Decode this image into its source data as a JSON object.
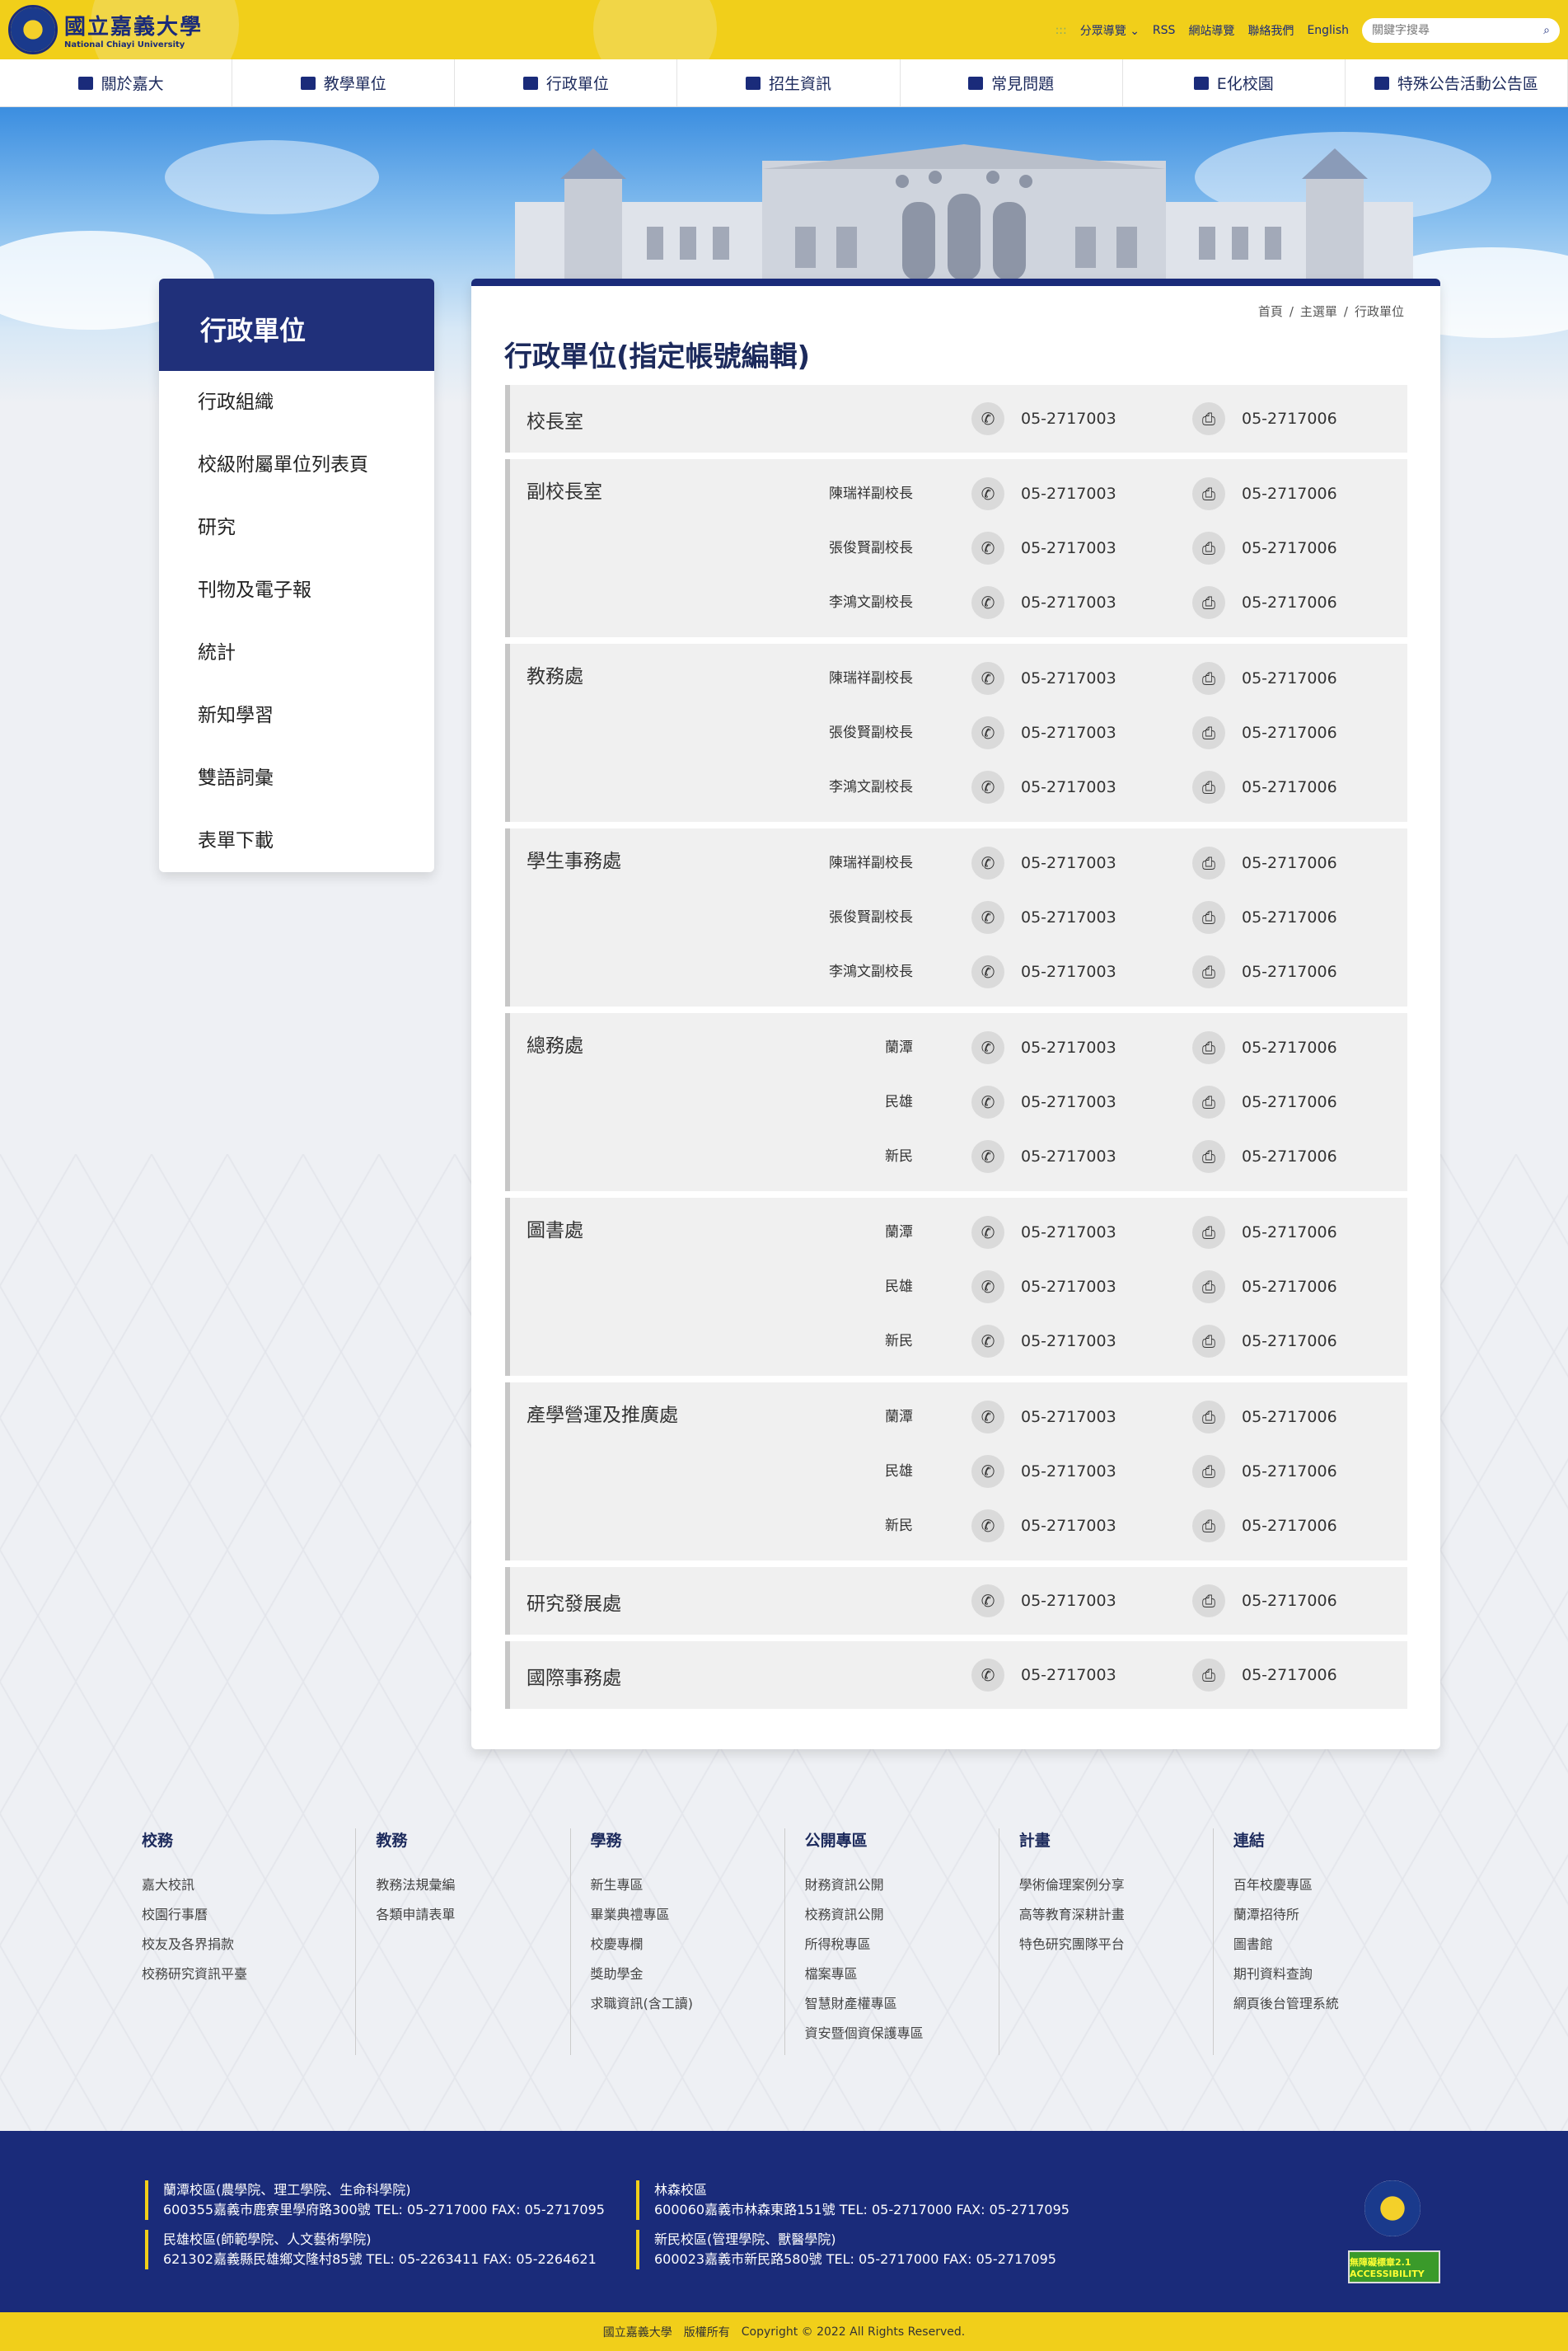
{
  "header": {
    "logo_zh": "國立嘉義大學",
    "logo_en": "National Chiayi University",
    "util": {
      "access": ":::",
      "sitemap_menu": "分眾導覽",
      "rss": "RSS",
      "sitemap": "網站導覽",
      "contact": "聯絡我們",
      "english": "English"
    },
    "search_placeholder": "關鍵字搜尋"
  },
  "nav": [
    "關於嘉大",
    "教學單位",
    "行政單位",
    "招生資訊",
    "常見問題",
    "E化校園",
    "特殊公告活動公告區"
  ],
  "sidebar": {
    "title": "行政單位",
    "items": [
      "行政組織",
      "校級附屬單位列表頁",
      "研究",
      "刊物及電子報",
      "統計",
      "新知學習",
      "雙語詞彙",
      "表單下載"
    ]
  },
  "breadcrumb": [
    "首頁",
    "/",
    "主選單",
    "/",
    "行政單位"
  ],
  "page_title": "行政單位(指定帳號編輯)",
  "units": [
    {
      "name": "校長室",
      "rows": [
        {
          "label": "",
          "tel": "05-2717003",
          "fax": "05-2717006"
        }
      ]
    },
    {
      "name": "副校長室",
      "rows": [
        {
          "label": "陳瑞祥副校長",
          "tel": "05-2717003",
          "fax": "05-2717006"
        },
        {
          "label": "張俊賢副校長",
          "tel": "05-2717003",
          "fax": "05-2717006"
        },
        {
          "label": "李鴻文副校長",
          "tel": "05-2717003",
          "fax": "05-2717006"
        }
      ]
    },
    {
      "name": "教務處",
      "rows": [
        {
          "label": "陳瑞祥副校長",
          "tel": "05-2717003",
          "fax": "05-2717006"
        },
        {
          "label": "張俊賢副校長",
          "tel": "05-2717003",
          "fax": "05-2717006"
        },
        {
          "label": "李鴻文副校長",
          "tel": "05-2717003",
          "fax": "05-2717006"
        }
      ]
    },
    {
      "name": "學生事務處",
      "rows": [
        {
          "label": "陳瑞祥副校長",
          "tel": "05-2717003",
          "fax": "05-2717006"
        },
        {
          "label": "張俊賢副校長",
          "tel": "05-2717003",
          "fax": "05-2717006"
        },
        {
          "label": "李鴻文副校長",
          "tel": "05-2717003",
          "fax": "05-2717006"
        }
      ]
    },
    {
      "name": "總務處",
      "rows": [
        {
          "label": "蘭潭",
          "tel": "05-2717003",
          "fax": "05-2717006"
        },
        {
          "label": "民雄",
          "tel": "05-2717003",
          "fax": "05-2717006"
        },
        {
          "label": "新民",
          "tel": "05-2717003",
          "fax": "05-2717006"
        }
      ]
    },
    {
      "name": "圖書處",
      "rows": [
        {
          "label": "蘭潭",
          "tel": "05-2717003",
          "fax": "05-2717006"
        },
        {
          "label": "民雄",
          "tel": "05-2717003",
          "fax": "05-2717006"
        },
        {
          "label": "新民",
          "tel": "05-2717003",
          "fax": "05-2717006"
        }
      ]
    },
    {
      "name": "產學營運及推廣處",
      "rows": [
        {
          "label": "蘭潭",
          "tel": "05-2717003",
          "fax": "05-2717006"
        },
        {
          "label": "民雄",
          "tel": "05-2717003",
          "fax": "05-2717006"
        },
        {
          "label": "新民",
          "tel": "05-2717003",
          "fax": "05-2717006"
        }
      ]
    },
    {
      "name": "研究發展處",
      "rows": [
        {
          "label": "",
          "tel": "05-2717003",
          "fax": "05-2717006"
        }
      ]
    },
    {
      "name": "國際事務處",
      "rows": [
        {
          "label": "",
          "tel": "05-2717003",
          "fax": "05-2717006"
        }
      ]
    }
  ],
  "footer_links": [
    {
      "title": "校務",
      "items": [
        "嘉大校訊",
        "校園行事曆",
        "校友及各界捐款",
        "校務研究資訊平臺"
      ]
    },
    {
      "title": "教務",
      "items": [
        "教務法規彙編",
        "各類申請表單"
      ]
    },
    {
      "title": "學務",
      "items": [
        "新生專區",
        "畢業典禮專區",
        "校慶專欄",
        "獎助學金",
        "求職資訊(含工讀)"
      ]
    },
    {
      "title": "公開專區",
      "items": [
        "財務資訊公開",
        "校務資訊公開",
        "所得稅專區",
        "檔案專區",
        "智慧財產權專區",
        "資安暨個資保護專區"
      ]
    },
    {
      "title": "計畫",
      "items": [
        "學術倫理案例分享",
        "高等教育深耕計畫",
        "特色研究團隊平台"
      ]
    },
    {
      "title": "連結",
      "items": [
        "百年校慶專區",
        "蘭潭招待所",
        "圖書館",
        "期刊資料查詢",
        "網頁後台管理系統"
      ]
    }
  ],
  "campuses": [
    {
      "name": "蘭潭校區(農學院、理工學院、生命科學院)",
      "addr": "600355嘉義市鹿寮里學府路300號 TEL: 05-2717000 FAX: 05-2717095"
    },
    {
      "name": "林森校區",
      "addr": "600060嘉義市林森東路151號 TEL: 05-2717000 FAX: 05-2717095"
    },
    {
      "name": "民雄校區(師範學院、人文藝術學院)",
      "addr": "621302嘉義縣民雄鄉文隆村85號 TEL: 05-2263411 FAX: 05-2264621"
    },
    {
      "name": "新民校區(管理學院、獸醫學院)",
      "addr": "600023嘉義市新民路580號 TEL: 05-2717000 FAX: 05-2717095"
    }
  ],
  "accessibility_badge": "無障礙標章2.1 ACCESSIBILITY",
  "copyright": [
    "國立嘉義大學",
    "版權所有",
    "Copyright © 2022 All Rights Reserved."
  ],
  "colors": {
    "brand_yellow": "#f1cf1a",
    "brand_navy": "#1a2b7a"
  }
}
